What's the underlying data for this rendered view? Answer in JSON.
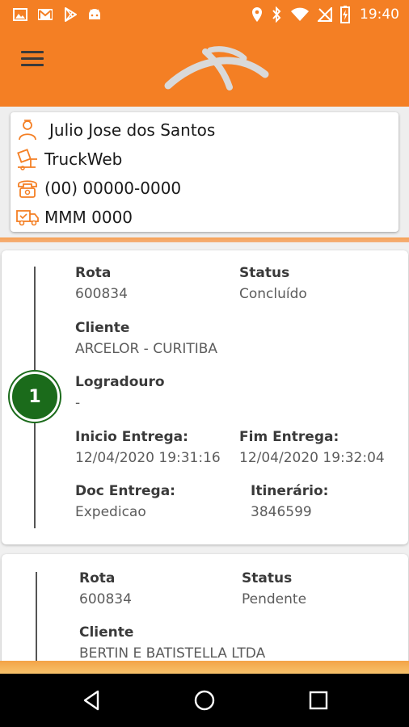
{
  "status_bar": {
    "time": "19:40",
    "left_icons": [
      "image-icon",
      "gmail-icon",
      "play-store-icon",
      "android-icon"
    ],
    "right_icons": [
      "location-icon",
      "bluetooth-icon",
      "wifi-icon",
      "no-signal-icon",
      "battery-charging-icon"
    ]
  },
  "header": {
    "menu_icon": "hamburger-menu-icon",
    "logo": "arcelor-swoosh-logo",
    "background": "#f47f24"
  },
  "driver": {
    "name": "Julio Jose dos Santos",
    "company": "TruckWeb",
    "phone": "(00) 00000-0000",
    "plate": "MMM 0000"
  },
  "deliveries": [
    {
      "number": "1",
      "rota_label": "Rota",
      "rota": "600834",
      "status_label": "Status",
      "status": "Concluído",
      "cliente_label": "Cliente",
      "cliente": "ARCELOR - CURITIBA",
      "logradouro_label": "Logradouro",
      "logradouro": "-",
      "inicio_label": "Inicio Entrega:",
      "inicio": "12/04/2020 19:31:16",
      "fim_label": "Fim Entrega:",
      "fim": "12/04/2020 19:32:04",
      "doc_label": "Doc Entrega:",
      "doc": "Expedicao",
      "itinerario_label": "Itinerário:",
      "itinerario": "3846599"
    },
    {
      "rota_label": "Rota",
      "rota": "600834",
      "status_label": "Status",
      "status": "Pendente",
      "cliente_label": "Cliente",
      "cliente": "BERTIN E BATISTELLA LTDA"
    }
  ],
  "colors": {
    "accent": "#f47f24",
    "badge_green": "#1b6b1b"
  },
  "navbar_icons": [
    "back-icon",
    "home-icon",
    "recents-icon"
  ]
}
